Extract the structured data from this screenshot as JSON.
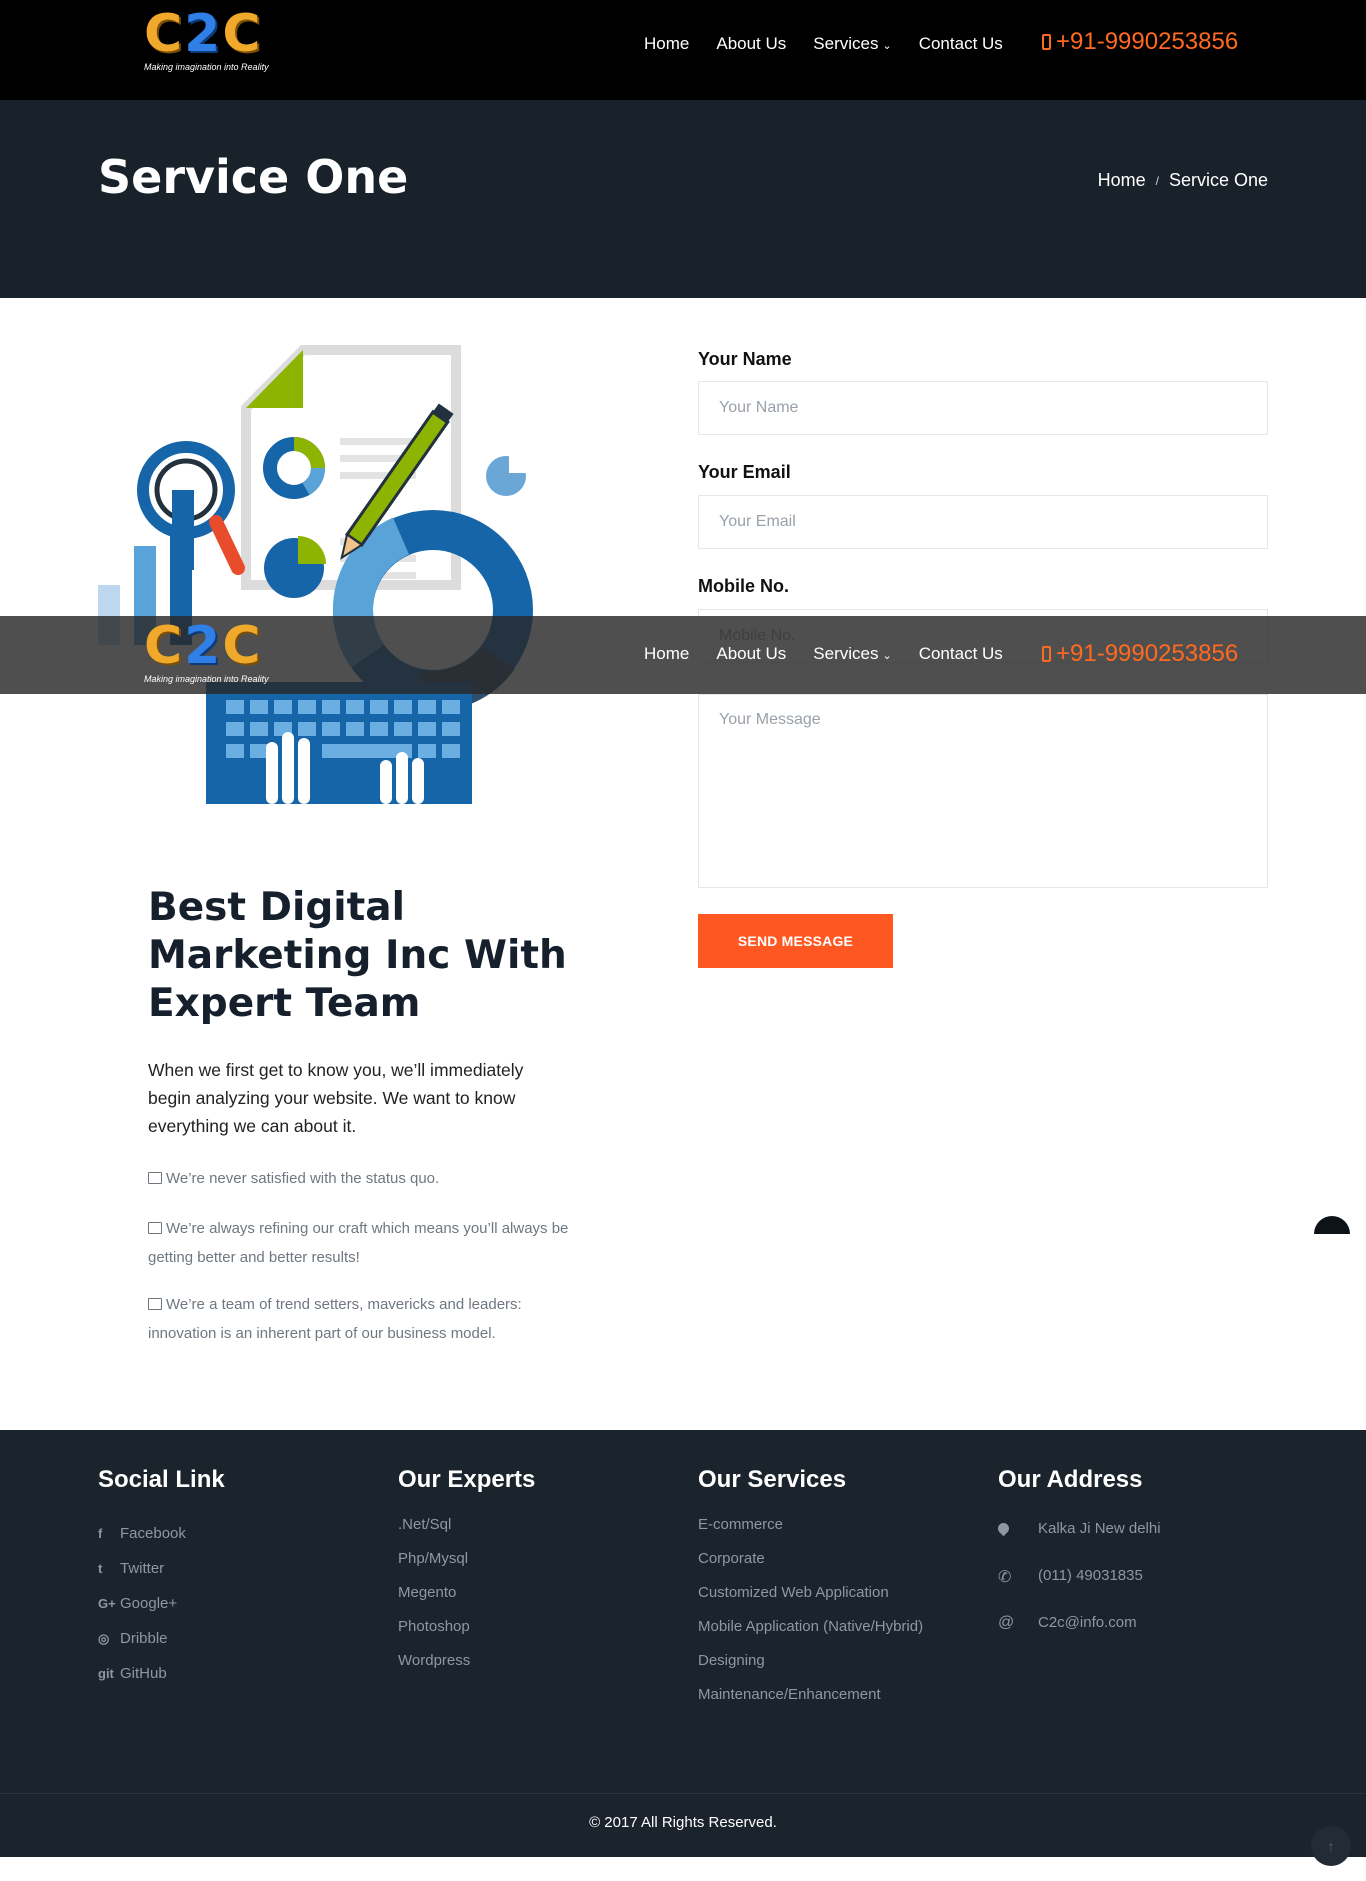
{
  "header": {
    "logo_text": "C2C",
    "logo_tagline": "Making imagination into Reality",
    "nav": [
      {
        "label": "Home"
      },
      {
        "label": "About Us"
      },
      {
        "label": "Services"
      },
      {
        "label": "Contact Us"
      }
    ],
    "phone": "+91-9990253856"
  },
  "hero": {
    "title": "Service One",
    "breadcrumb": {
      "home": "Home",
      "separator": "/",
      "current": "Service One"
    }
  },
  "content": {
    "heading": "Best Digital Marketing Inc With Expert Team",
    "lead": "When we first get to know you, we’ll immediately begin analyzing your website. We want to know everything we can about it.",
    "points": [
      "We’re never satisfied with the status quo.",
      "We’re always refining our craft which means you’ll always be getting better and better results!",
      "We’re a team of trend setters, mavericks and leaders: innovation is an inherent part of our business model."
    ]
  },
  "form": {
    "name": {
      "label": "Your Name",
      "placeholder": "Your Name",
      "value": ""
    },
    "email": {
      "label": "Your Email",
      "placeholder": "Your Email",
      "value": ""
    },
    "mobile": {
      "label": "Mobile No.",
      "placeholder": "Mobile No.",
      "value": ""
    },
    "message": {
      "placeholder": "Your Message",
      "value": ""
    },
    "submit_label": "SEND MESSAGE"
  },
  "footer": {
    "social": {
      "title": "Social Link",
      "items": [
        {
          "icon": "facebook-icon",
          "glyph": "f",
          "label": "Facebook"
        },
        {
          "icon": "twitter-icon",
          "glyph": "t",
          "label": "Twitter"
        },
        {
          "icon": "google-plus-icon",
          "glyph": "G+",
          "label": "Google+"
        },
        {
          "icon": "dribbble-icon",
          "glyph": "◎",
          "label": "Dribble"
        },
        {
          "icon": "git-icon",
          "glyph": "git",
          "label": "GitHub"
        }
      ]
    },
    "experts": {
      "title": "Our Experts",
      "items": [
        ".Net/Sql",
        "Php/Mysql",
        "Megento",
        "Photoshop",
        "Wordpress"
      ]
    },
    "services": {
      "title": "Our Services",
      "items": [
        "E-commerce",
        "Corporate",
        "Customized Web Application",
        "Mobile Application (Native/Hybrid)",
        "Designing",
        "Maintenance/Enhancement"
      ]
    },
    "address": {
      "title": "Our Address",
      "location": "Kalka Ji New delhi",
      "phone": "(011) 49031835",
      "email_symbol": "@",
      "email": "C2c@info.com"
    },
    "copyright": "© 2017 All Rights Reserved.",
    "to_top_glyph": "↑"
  },
  "colors": {
    "accent": "#ff5722",
    "phone": "#ff6a1f",
    "hero_bg": "#19212a",
    "footer_bg": "#1b232c",
    "illustration_blue": "#1565a8",
    "illustration_green": "#8cb400"
  }
}
